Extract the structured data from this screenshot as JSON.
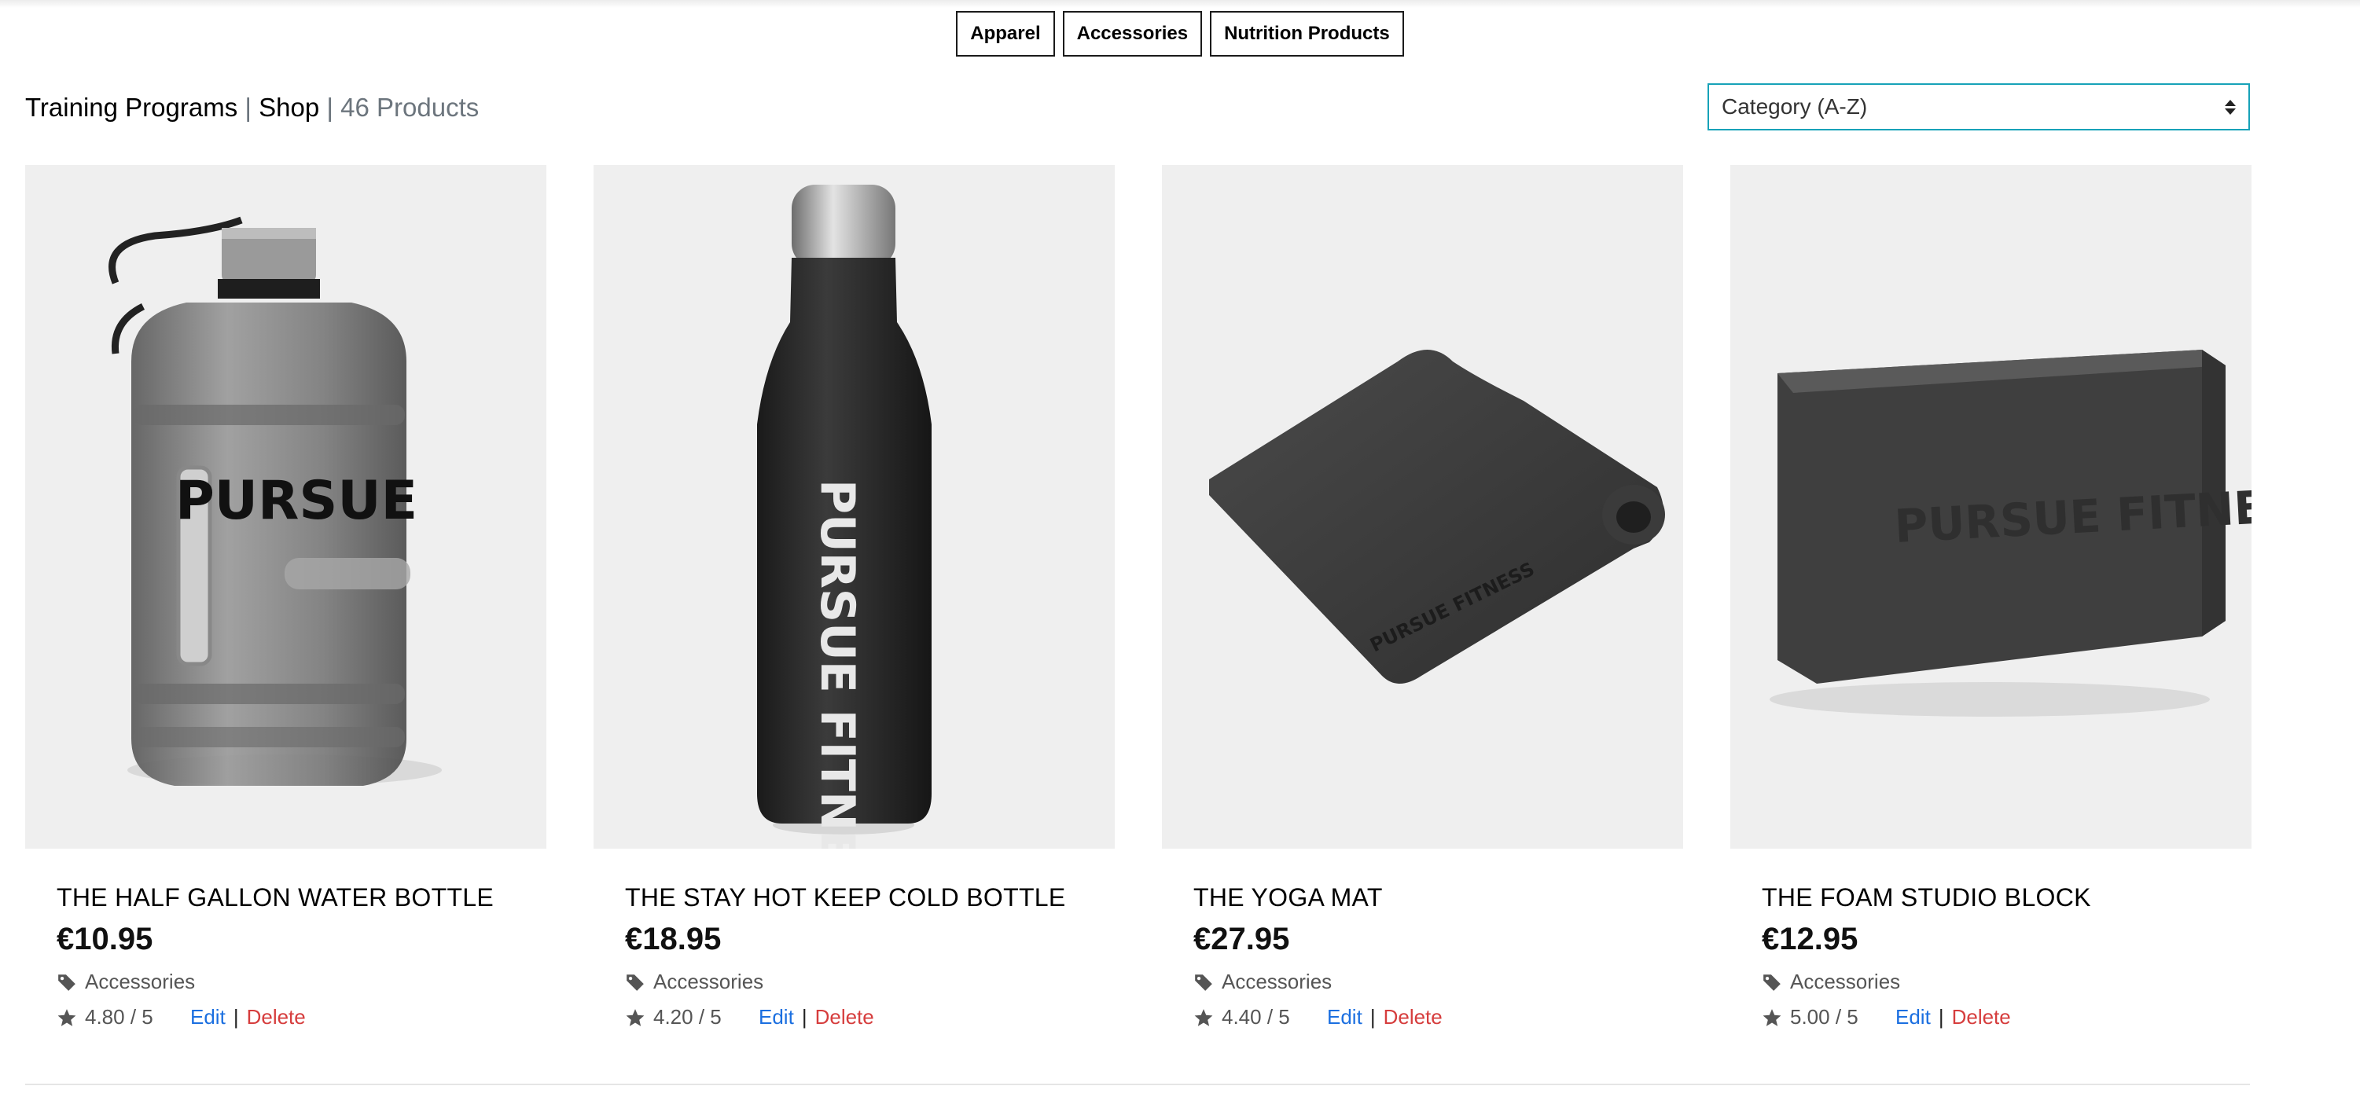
{
  "filters": [
    "Apparel",
    "Accessories",
    "Nutrition Products"
  ],
  "breadcrumb": {
    "training_programs": "Training Programs",
    "separator": "|",
    "shop": "Shop",
    "count": "46 Products"
  },
  "sort": {
    "selected": "Category (A-Z)"
  },
  "products": [
    {
      "title": "THE HALF GALLON WATER BOTTLE",
      "price": "€10.95",
      "category": "Accessories",
      "rating": "4.80 / 5",
      "edit": "Edit",
      "delete": "Delete",
      "brand_text": "PURSUE",
      "icon": "water-jug"
    },
    {
      "title": "THE STAY HOT KEEP COLD BOTTLE",
      "price": "€18.95",
      "category": "Accessories",
      "rating": "4.20 / 5",
      "edit": "Edit",
      "delete": "Delete",
      "brand_text": "PURSUE FITNESS",
      "icon": "steel-bottle"
    },
    {
      "title": "THE YOGA MAT",
      "price": "€27.95",
      "category": "Accessories",
      "rating": "4.40 / 5",
      "edit": "Edit",
      "delete": "Delete",
      "brand_text": "PURSUE FITNESS",
      "icon": "yoga-mat"
    },
    {
      "title": "THE FOAM STUDIO BLOCK",
      "price": "€12.95",
      "category": "Accessories",
      "rating": "5.00 / 5",
      "edit": "Edit",
      "delete": "Delete",
      "brand_text": "PURSUE FITNESS",
      "icon": "foam-block"
    }
  ],
  "colors": {
    "accent_select_border": "#17a2b8",
    "edit_link": "#1b6fe0",
    "delete_link": "#d63d3d",
    "image_bg": "#efefef"
  }
}
